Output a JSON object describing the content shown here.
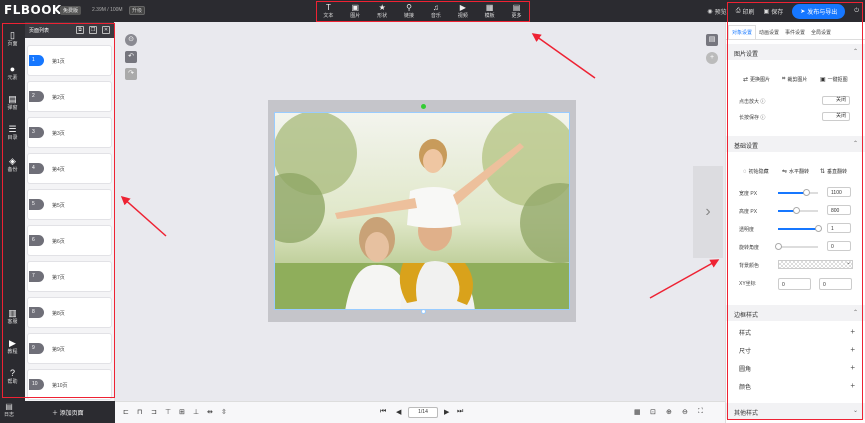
{
  "topbar": {
    "logo": "FLBOOK",
    "badge": "免费版",
    "storage": "2.39M / 100M",
    "upgrade": "升级",
    "tools": [
      {
        "icon": "text-icon",
        "glyph": "T",
        "label": "文本"
      },
      {
        "icon": "image-icon",
        "glyph": "▣",
        "label": "图片"
      },
      {
        "icon": "shape-icon",
        "glyph": "★",
        "label": "形状"
      },
      {
        "icon": "link-icon",
        "glyph": "⚲",
        "label": "链接"
      },
      {
        "icon": "music-icon",
        "glyph": "♫",
        "label": "音乐"
      },
      {
        "icon": "video-icon",
        "glyph": "▶",
        "label": "视频"
      },
      {
        "icon": "template-icon",
        "glyph": "▦",
        "label": "模板"
      },
      {
        "icon": "more-icon",
        "glyph": "▤",
        "label": "更多"
      }
    ],
    "preview": "预览",
    "print": "印刷",
    "save": "保存",
    "publish": "发布与导出"
  },
  "rail": [
    {
      "icon": "page-icon",
      "glyph": "▯",
      "label": "页面"
    },
    {
      "icon": "element-icon",
      "glyph": "●",
      "label": "元素"
    },
    {
      "icon": "popup-icon",
      "glyph": "▤",
      "label": "弹窗"
    },
    {
      "icon": "catalog-icon",
      "glyph": "☰",
      "label": "目录"
    },
    {
      "icon": "backup-icon",
      "glyph": "◈",
      "label": "备份"
    },
    {
      "icon": "help-icon-book",
      "glyph": "▥",
      "label": "客服"
    },
    {
      "icon": "tutorial-icon",
      "glyph": "▶",
      "label": "教程"
    },
    {
      "icon": "help-icon",
      "glyph": "?",
      "label": "帮助"
    }
  ],
  "pagelist": {
    "title": "页面列表",
    "pages": [
      {
        "num": "1",
        "label": "第1页"
      },
      {
        "num": "2",
        "label": "第2页"
      },
      {
        "num": "3",
        "label": "第3页"
      },
      {
        "num": "4",
        "label": "第4页"
      },
      {
        "num": "5",
        "label": "第5页"
      },
      {
        "num": "6",
        "label": "第6页"
      },
      {
        "num": "7",
        "label": "第7页"
      },
      {
        "num": "8",
        "label": "第8页"
      },
      {
        "num": "9",
        "label": "第9页"
      },
      {
        "num": "10",
        "label": "第10页"
      }
    ],
    "add_page": "添加页面",
    "log": "日志"
  },
  "bottombar": {
    "page_indicator": "1/14"
  },
  "props": {
    "tabs": [
      "对象设置",
      "动画设置",
      "事件设置",
      "全局设置"
    ],
    "image_section": {
      "title": "图片设置",
      "replace": "更换图片",
      "crop": "裁剪图片",
      "matting": "一键抠图",
      "click_zoom": "点击放大",
      "long_press": "长按保存",
      "off": "关闭"
    },
    "basic_section": {
      "title": "基础设置",
      "hide": "初始隐藏",
      "flip_h": "水平翻转",
      "flip_v": "垂直翻转",
      "width_label": "宽度 PX",
      "width": "1100",
      "width_level": 0.7,
      "height_label": "高度 PX",
      "height": "800",
      "height_level": 0.45,
      "opacity_label": "透明度",
      "opacity": "1",
      "opacity_level": 1,
      "rotate_label": "旋转角度",
      "rotate": "0",
      "rotate_level": 0,
      "bg_label": "背景颜色",
      "xy_label": "XY坐标",
      "x": "0",
      "y": "0"
    },
    "border_section": {
      "title": "边框样式",
      "rows": [
        "样式",
        "尺寸",
        "圆角",
        "颜色"
      ]
    },
    "other_section": {
      "title": "其他样式"
    }
  }
}
